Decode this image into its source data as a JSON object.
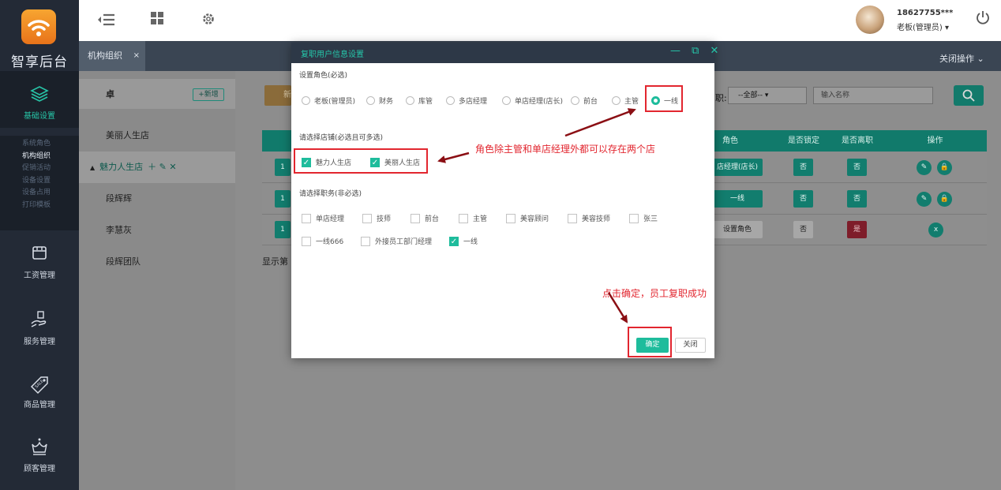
{
  "app": {
    "logo_text": "智享后台"
  },
  "sidebar": {
    "sections": [
      {
        "label": "基础设置",
        "icon": "layers-icon"
      },
      {
        "label": "工资管理",
        "icon": "wallet-icon"
      },
      {
        "label": "服务管理",
        "icon": "hand-service-icon"
      },
      {
        "label": "商品管理",
        "icon": "tag-icon"
      },
      {
        "label": "顾客管理",
        "icon": "crown-icon"
      }
    ],
    "sub_items": [
      "系统角色",
      "机构组织",
      "促销活动",
      "设备设置",
      "设备占用",
      "打印模板"
    ]
  },
  "topbar": {
    "user_phone": "18627755***",
    "user_role": "老板(管理员) ▾"
  },
  "tabs": {
    "active": "机构组织",
    "close": "×",
    "close_ops": "关闭操作 ⌄"
  },
  "tree": {
    "root": "卓",
    "add_label": "+新增",
    "items": [
      "美丽人生店",
      "魅力人生店",
      "段辉辉",
      "李慧灰",
      "段辉团队"
    ]
  },
  "filter": {
    "label": "职:",
    "select": "--全部--  ▾",
    "input_placeholder": "输入名称",
    "new_btn": "新"
  },
  "grid": {
    "headers": [
      "角色",
      "是否锁定",
      "是否离职",
      "操作"
    ],
    "rows": [
      {
        "num": "1",
        "role": "店经理(店长)",
        "locked": "否",
        "left": "否"
      },
      {
        "num": "1",
        "role": "一线",
        "locked": "否",
        "left": "否"
      },
      {
        "num": "1",
        "role": "设置角色",
        "locked": "否",
        "left": "是"
      }
    ],
    "pager": "显示第 1"
  },
  "modal": {
    "title": "复职用户信息设置",
    "controls": "— ⧉ ✕",
    "role_label": "设置角色(必选)",
    "roles": [
      {
        "label": "老板(管理员)",
        "selected": false
      },
      {
        "label": "财务",
        "selected": false
      },
      {
        "label": "库管",
        "selected": false
      },
      {
        "label": "多店经理",
        "selected": false
      },
      {
        "label": "单店经理(店长)",
        "selected": false
      },
      {
        "label": "前台",
        "selected": false
      },
      {
        "label": "主管",
        "selected": false
      },
      {
        "label": "一线",
        "selected": true
      }
    ],
    "store_label": "请选择店铺(必选且可多选)",
    "stores": [
      {
        "label": "魅力人生店",
        "checked": true
      },
      {
        "label": "美丽人生店",
        "checked": true
      }
    ],
    "position_label": "请选择职务(非必选)",
    "positions": [
      {
        "label": "单店经理",
        "checked": false
      },
      {
        "label": "技师",
        "checked": false
      },
      {
        "label": "前台",
        "checked": false
      },
      {
        "label": "主管",
        "checked": false
      },
      {
        "label": "美容顾问",
        "checked": false
      },
      {
        "label": "美容技师",
        "checked": false
      },
      {
        "label": "张三",
        "checked": false
      },
      {
        "label": "一线666",
        "checked": false
      },
      {
        "label": "外接员工部门经理",
        "checked": false
      },
      {
        "label": "一线",
        "checked": true
      }
    ],
    "confirm": "确定",
    "close": "关闭"
  },
  "annotations": {
    "stores_note": "角色除主管和单店经理外都可以存在两个店",
    "confirm_note": "点击确定，员工复职成功"
  },
  "colors": {
    "accent": "#1ebc9c",
    "sidebar": "#232a36",
    "annotation": "#e2262f"
  }
}
